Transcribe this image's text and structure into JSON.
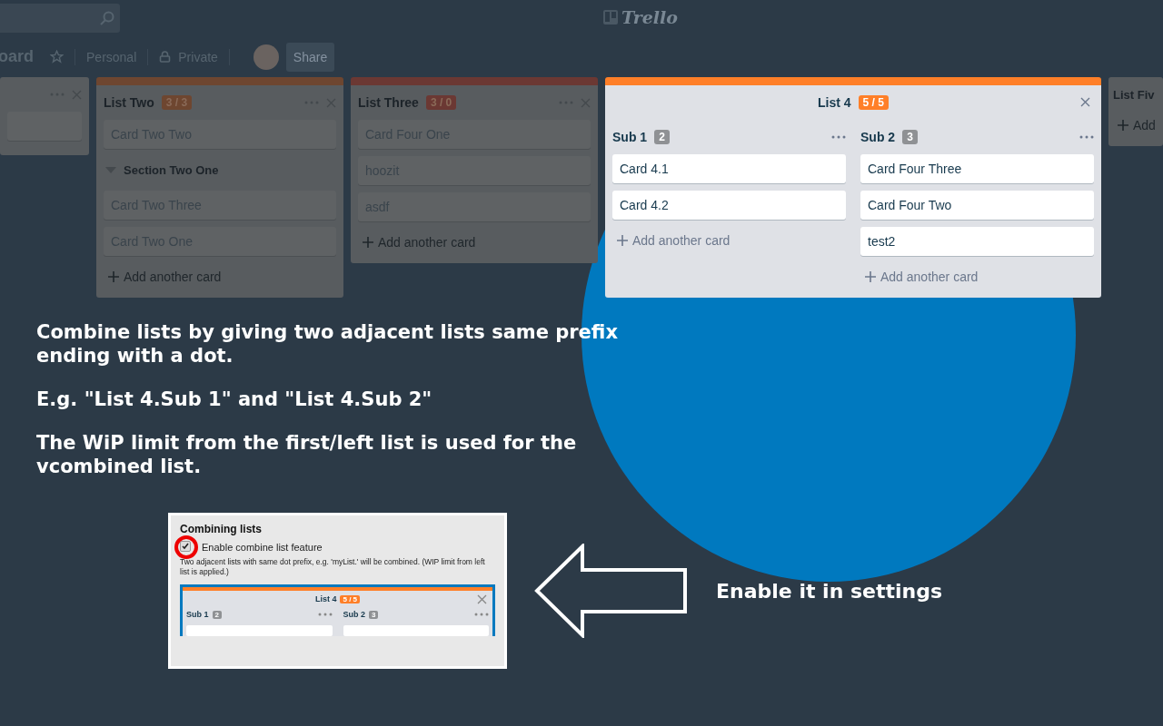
{
  "top_bar": {
    "logo": "Trello"
  },
  "board_header": {
    "title": "oard",
    "team": "Personal",
    "visibility": "Private",
    "share": "Share"
  },
  "lists": [
    {
      "kind": "partial"
    },
    {
      "kind": "simple",
      "title": "List Two",
      "wip": "3 / 3",
      "color": "#6e4630",
      "items": [
        {
          "kind": "card",
          "text": "Card Two Two"
        },
        {
          "kind": "section",
          "text": "Section Two One",
          "expanded": true
        },
        {
          "kind": "card",
          "text": "Card Two Three"
        },
        {
          "kind": "card",
          "text": "Card Two One"
        }
      ],
      "add": "Add another card"
    },
    {
      "kind": "simple",
      "title": "List Three",
      "wip": "3 / 0",
      "color": "#6b3833",
      "items": [
        {
          "kind": "card",
          "text": "Card Four One"
        },
        {
          "kind": "card",
          "text": "hoozit"
        },
        {
          "kind": "card",
          "text": "asdf"
        }
      ],
      "add": "Add another card"
    },
    {
      "kind": "combined",
      "title": "List 4",
      "wip": "5 / 5",
      "color": "#ff7f28",
      "sublists": [
        {
          "title": "Sub 1",
          "count": "2",
          "cards": [
            "Card 4.1",
            "Card 4.2"
          ],
          "add": "Add another card"
        },
        {
          "title": "Sub 2",
          "count": "3",
          "cards": [
            "Card Four Three",
            "Card Four Two",
            "test2"
          ],
          "add": "Add another card"
        }
      ]
    },
    {
      "kind": "edge",
      "title": "List Fiv",
      "add": "Add"
    }
  ],
  "instructions": [
    "Combine lists by giving two adjacent lists same prefix ending with a dot.",
    "E.g. \"List 4.Sub 1\" and \"List 4.Sub 2\"",
    "The WiP limit from the first/left list is used for the vcombined list."
  ],
  "settings_preview": {
    "title": "Combining lists",
    "option": {
      "label": "Enable combine list feature",
      "checked": true
    },
    "description": "Two adjacent lists with same dot prefix, e.g. 'myList.' will be combined. (WIP limit from left list is applied.)",
    "list": {
      "title": "List 4",
      "wip": "5 / 5",
      "sublists": [
        {
          "title": "Sub 1",
          "count": "2"
        },
        {
          "title": "Sub 2",
          "count": "3"
        }
      ]
    }
  },
  "callout": "Enable it in settings"
}
